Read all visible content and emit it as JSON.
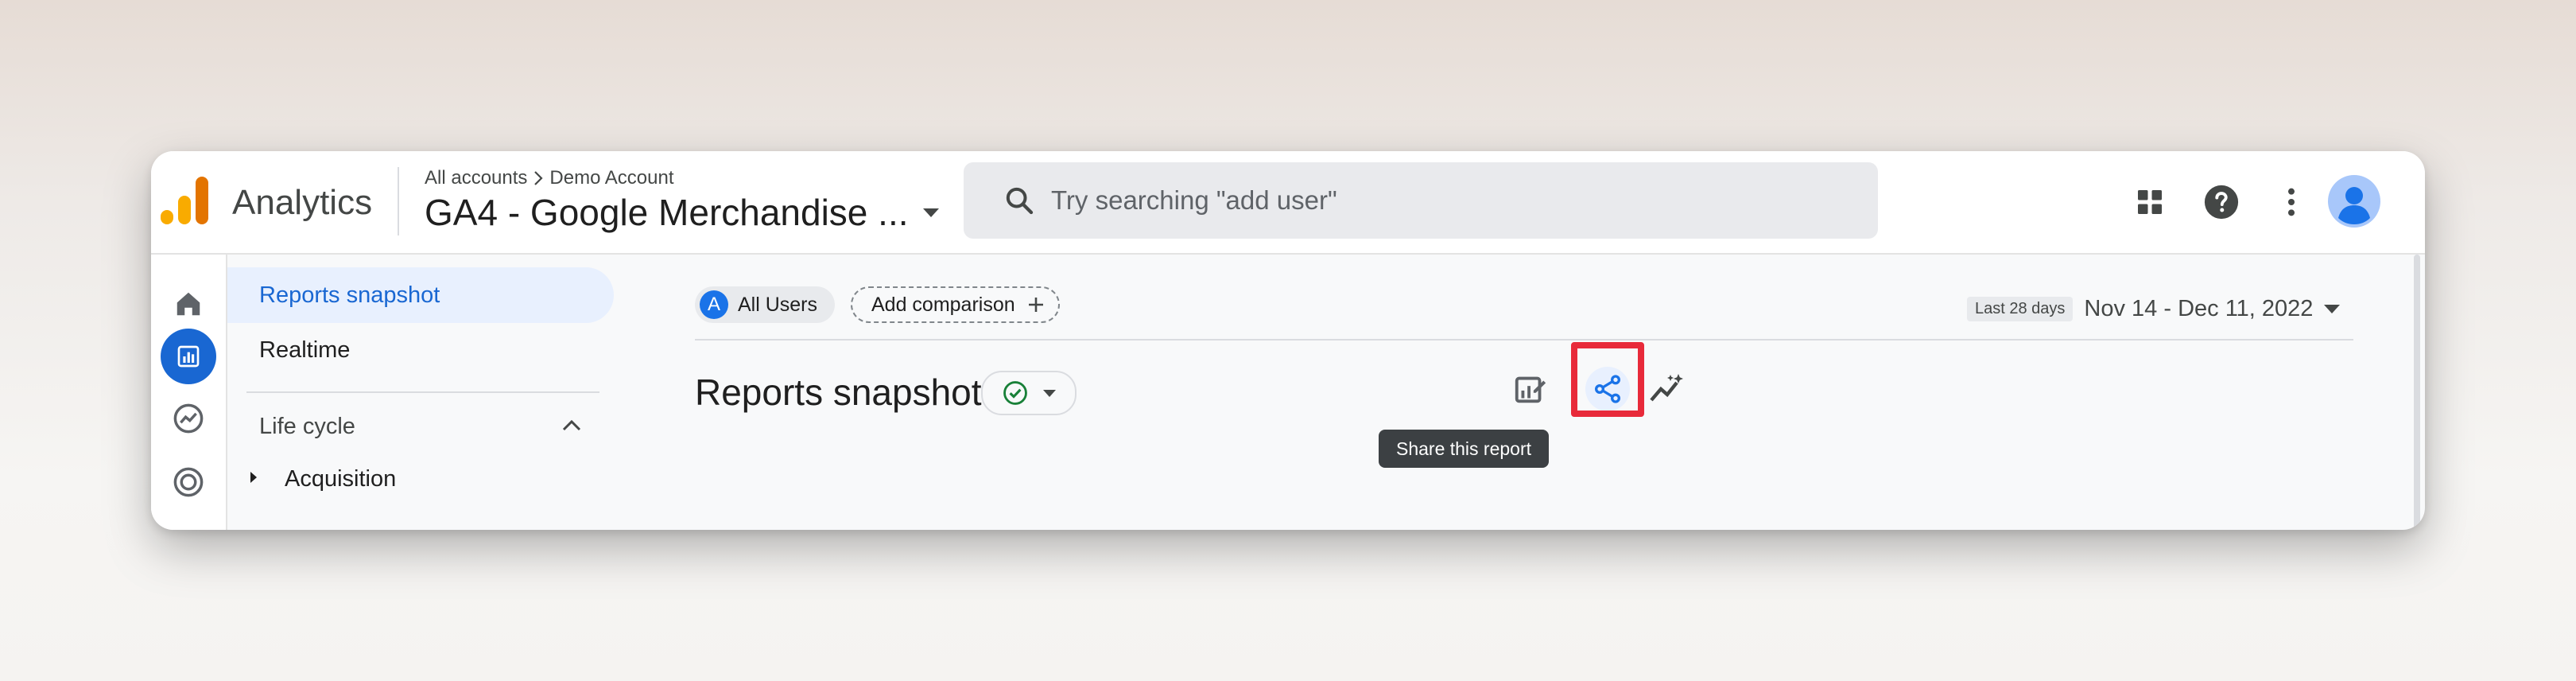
{
  "app": {
    "name": "Analytics"
  },
  "breadcrumb": {
    "root": "All accounts",
    "account": "Demo Account"
  },
  "property": {
    "name": "GA4 - Google Merchandise ..."
  },
  "search": {
    "placeholder": "Try searching \"add user\""
  },
  "topbar_icons": [
    "apps-grid-icon",
    "help-icon",
    "more-vert-icon",
    "account-avatar-icon"
  ],
  "rail": {
    "items": [
      "home-icon",
      "reports-icon",
      "explore-icon",
      "advertising-icon"
    ],
    "active": "reports-icon"
  },
  "nav": {
    "items": [
      {
        "label": "Reports snapshot",
        "active": true
      },
      {
        "label": "Realtime",
        "active": false
      }
    ],
    "section": {
      "label": "Life cycle",
      "expanded": true
    },
    "subitems": [
      {
        "label": "Acquisition",
        "expanded": false
      }
    ]
  },
  "comparison": {
    "segment_letter": "A",
    "segment_label": "All Users",
    "add_label": "Add comparison"
  },
  "date": {
    "badge": "Last 28 days",
    "range": "Nov 14 - Dec 11, 2022"
  },
  "report": {
    "title": "Reports snapshot",
    "actions": [
      "customize-report-icon",
      "share-icon",
      "insights-icon"
    ],
    "tooltip": "Share this report"
  },
  "colors": {
    "accent": "#1a73e8",
    "active_bg": "#e8f0fe",
    "highlight": "#e82a3a",
    "logo": [
      "#f9ab00",
      "#e37400"
    ]
  }
}
